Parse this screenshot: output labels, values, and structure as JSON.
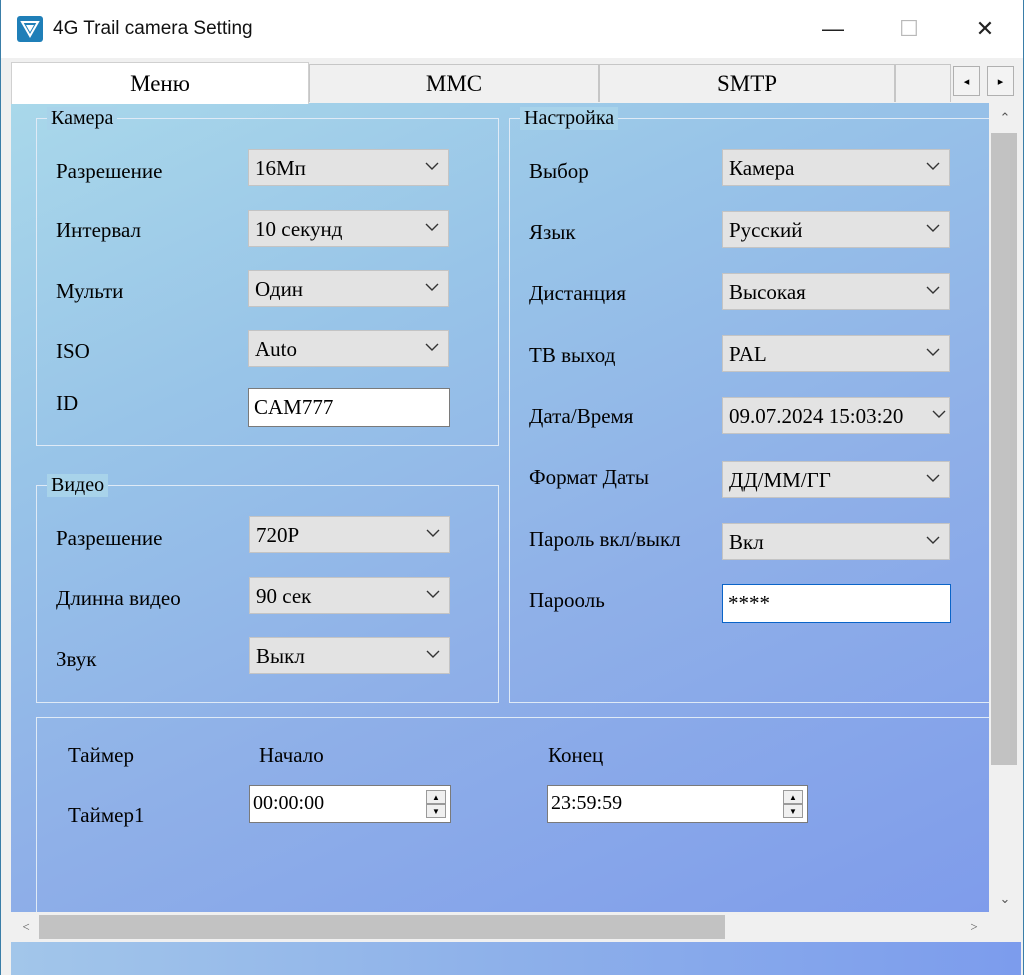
{
  "window": {
    "title": "4G Trail camera Setting",
    "controls": {
      "minimize": "—",
      "maximize": "☐",
      "close": "✕"
    }
  },
  "tabs": [
    {
      "label": "Меню",
      "active": true
    },
    {
      "label": "MMC",
      "active": false
    },
    {
      "label": "SMTP",
      "active": false
    }
  ],
  "tab_scroll": {
    "left": "◂",
    "right": "▸"
  },
  "camera_group": {
    "title": "Камера",
    "resolution": {
      "label": "Разрешение",
      "value": "16Мп"
    },
    "interval": {
      "label": "Интервал",
      "value": "10 секунд"
    },
    "multi": {
      "label": "Мульти",
      "value": "Один"
    },
    "iso": {
      "label": "ISO",
      "value": "Auto"
    },
    "id": {
      "label": "ID",
      "value": "CAM777"
    }
  },
  "video_group": {
    "title": "Видео",
    "resolution": {
      "label": "Разрешение",
      "value": "720P"
    },
    "length": {
      "label": "Длинна видео",
      "value": "90 сек"
    },
    "sound": {
      "label": "Звук",
      "value": "Выкл"
    }
  },
  "settings_group": {
    "title": "Настройка",
    "mode": {
      "label": "Выбор",
      "value": "Камера"
    },
    "language": {
      "label": "Язык",
      "value": "Русский"
    },
    "distance": {
      "label": "Дистанция",
      "value": "Высокая"
    },
    "tv_out": {
      "label": "ТВ выход",
      "value": "PAL"
    },
    "datetime": {
      "label": "Дата/Время",
      "value": "09.07.2024 15:03:20"
    },
    "date_format": {
      "label": "Формат Даты",
      "value": "ДД/ММ/ГГ"
    },
    "password_toggle": {
      "label": "Пароль вкл/выкл",
      "value": "Вкл"
    },
    "password": {
      "label": "Парооль",
      "value": "****"
    }
  },
  "timer_group": {
    "col_timer": "Таймер",
    "col_start": "Начало",
    "col_end": "Конец",
    "row_label": "Таймер1",
    "start": "00:00:00",
    "end": "23:59:59"
  },
  "scrollbars": {
    "up": "⌃",
    "down": "⌄",
    "left": "<",
    "right": ">"
  },
  "colors": {
    "content_gradient_start": "#a9d8ea",
    "content_gradient_end": "#7f9ceb",
    "focus_border": "#0a64c8"
  }
}
